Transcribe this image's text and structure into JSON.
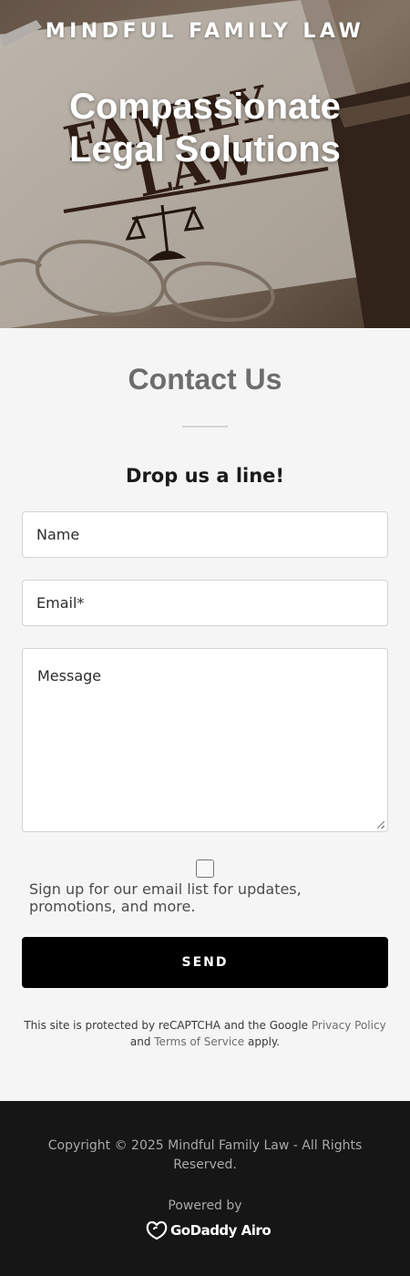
{
  "hero": {
    "brand": "MINDFUL FAMILY LAW",
    "tagline": "Compassionate Legal Solutions",
    "book_text_1": "FAMILY",
    "book_text_2": "LAW"
  },
  "contact": {
    "title": "Contact Us",
    "subtitle": "Drop us a line!",
    "fields": {
      "name_placeholder": "Name",
      "email_placeholder": "Email*",
      "message_placeholder": "Message"
    },
    "signup_label": "Sign up for our email list for updates, promotions, and more.",
    "send_label": "SEND",
    "recaptcha": {
      "prefix": "This site is protected by reCAPTCHA and the Google",
      "privacy_link": "Privacy Policy",
      "middle": "and",
      "terms_link": "Terms of Service",
      "suffix": "apply."
    }
  },
  "footer": {
    "copyright": "Copyright © 2025 Mindful Family Law - All Rights Reserved.",
    "powered_by": "Powered by",
    "provider": "GoDaddy Airo",
    "provider_icon": "godaddy-logo-icon"
  },
  "colors": {
    "button_bg": "#000000",
    "footer_bg": "#161616",
    "page_bg": "#f5f5f5"
  }
}
